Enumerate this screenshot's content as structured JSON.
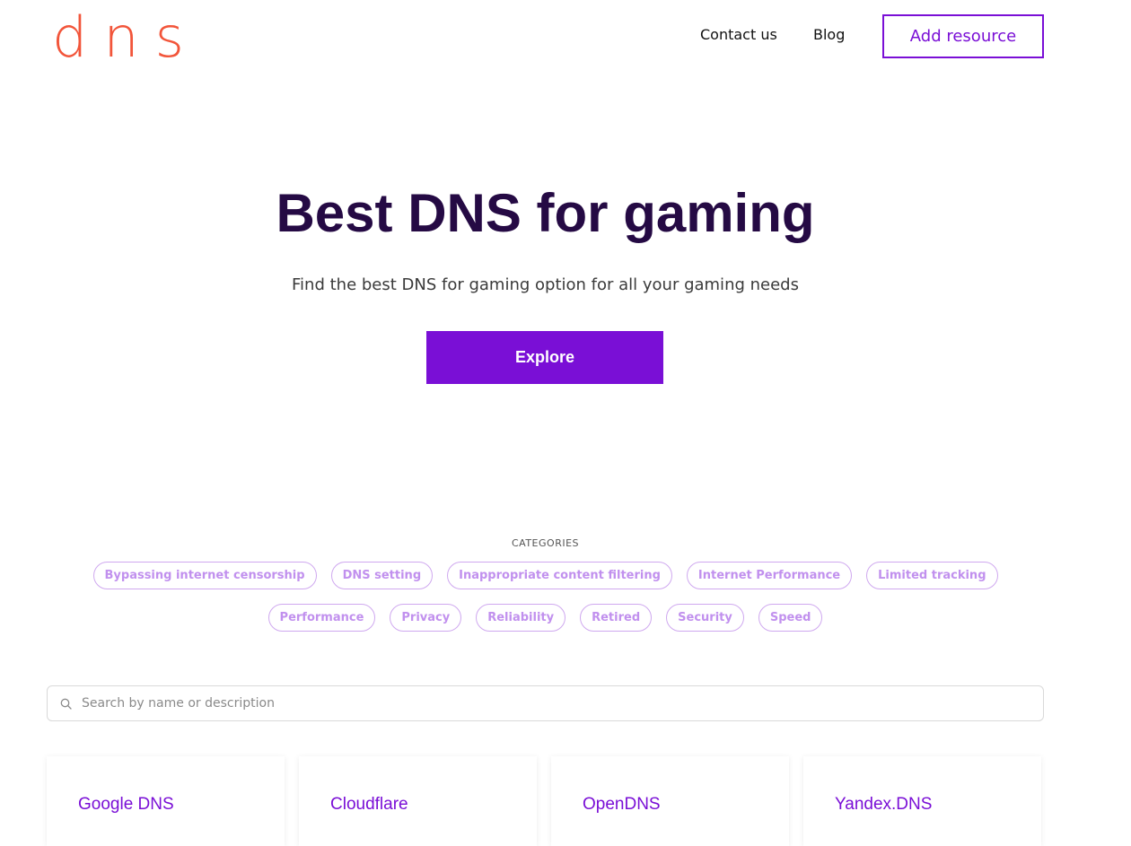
{
  "header": {
    "logo": "dns",
    "nav": [
      "Contact us",
      "Blog"
    ],
    "add_button": "Add resource"
  },
  "hero": {
    "title": "Best DNS for gaming",
    "subtitle": "Find the best DNS for gaming option for all your gaming needs",
    "explore_button": "Explore"
  },
  "categories": {
    "label": "CATEGORIES",
    "row1": [
      "Bypassing internet censorship",
      "DNS setting",
      "Inappropriate content filtering",
      "Internet Performance",
      "Limited tracking"
    ],
    "row2": [
      "Performance",
      "Privacy",
      "Reliability",
      "Retired",
      "Security",
      "Speed"
    ]
  },
  "search": {
    "placeholder": "Search by name or description",
    "icon": "search-icon"
  },
  "cards": [
    "Google DNS",
    "Cloudflare",
    "OpenDNS",
    "Yandex.DNS"
  ],
  "colors": {
    "brand": "#f2553a",
    "accent": "#7a0fd6",
    "title": "#250a44",
    "chip": "#c190ee"
  }
}
